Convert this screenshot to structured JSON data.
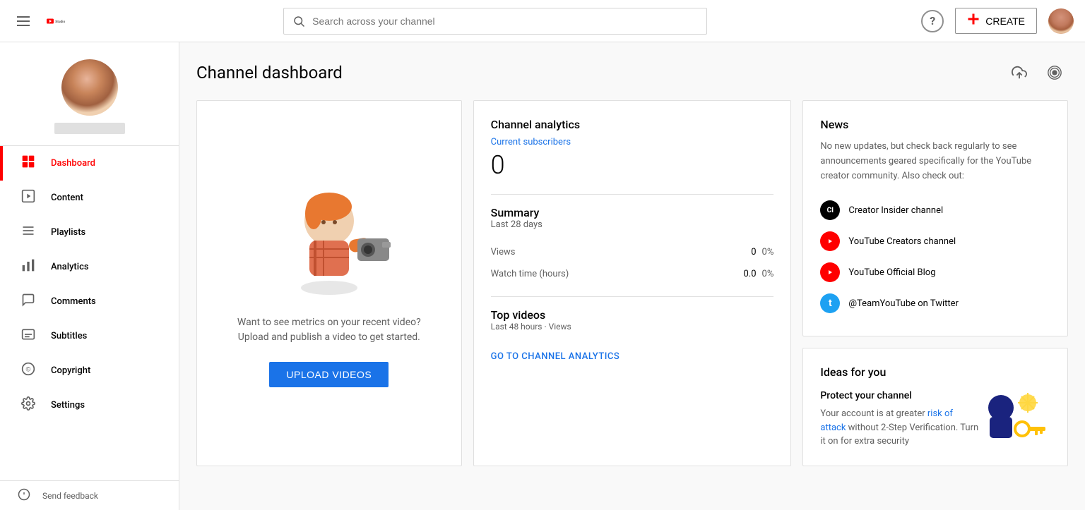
{
  "header": {
    "menu_icon": "☰",
    "logo_text": "Studio",
    "search_placeholder": "Search across your channel",
    "help_icon": "?",
    "create_label": "CREATE",
    "avatar_alt": "user avatar"
  },
  "sidebar": {
    "username": "",
    "items": [
      {
        "id": "dashboard",
        "label": "Dashboard",
        "icon": "⊞",
        "active": true
      },
      {
        "id": "content",
        "label": "Content",
        "icon": "▷",
        "active": false
      },
      {
        "id": "playlists",
        "label": "Playlists",
        "icon": "≡",
        "active": false
      },
      {
        "id": "analytics",
        "label": "Analytics",
        "icon": "▦",
        "active": false
      },
      {
        "id": "comments",
        "label": "Comments",
        "icon": "💬",
        "active": false
      },
      {
        "id": "subtitles",
        "label": "Subtitles",
        "icon": "⊟",
        "active": false
      },
      {
        "id": "copyright",
        "label": "Copyright",
        "icon": "©",
        "active": false
      },
      {
        "id": "settings",
        "label": "Settings",
        "icon": "⚙",
        "active": false
      }
    ],
    "bottom_items": [
      {
        "id": "send-feedback",
        "label": "Send feedback",
        "icon": "!"
      }
    ]
  },
  "main": {
    "page_title": "Channel dashboard",
    "upload_area": {
      "empty_text": "Want to see metrics on your recent video?\nUpload and publish a video to get started.",
      "upload_button_label": "UPLOAD VIDEOS"
    },
    "analytics": {
      "title": "Channel analytics",
      "current_subscribers_label": "Current subscribers",
      "subscribers_count": "0",
      "summary_title": "Summary",
      "summary_period": "Last 28 days",
      "metrics": [
        {
          "label": "Views",
          "value": "0",
          "pct": "0%"
        },
        {
          "label": "Watch time (hours)",
          "value": "0.0",
          "pct": "0%"
        }
      ],
      "top_videos_title": "Top videos",
      "top_videos_sub": "Last 48 hours · Views",
      "go_analytics_label": "GO TO CHANNEL ANALYTICS"
    },
    "news": {
      "title": "News",
      "description": "No new updates, but check back regularly to see announcements geared specifically for the YouTube creator community. Also check out:",
      "channels": [
        {
          "id": "creator-insider",
          "name": "Creator Insider channel",
          "initials": "CI",
          "type": "ci"
        },
        {
          "id": "yt-creators",
          "name": "YouTube Creators channel",
          "initials": "▶",
          "type": "yt"
        },
        {
          "id": "yt-blog",
          "name": "YouTube Official Blog",
          "initials": "▶",
          "type": "blog"
        },
        {
          "id": "twitter",
          "name": "@TeamYouTube on Twitter",
          "initials": "t",
          "type": "twitter"
        }
      ]
    },
    "ideas": {
      "title": "Ideas for you",
      "protect_title": "Protect your channel",
      "protect_text": "Your account is at greater risk of attack without 2-Step Verification. Turn it on for extra security",
      "protect_link_text": "risk of attack"
    }
  }
}
